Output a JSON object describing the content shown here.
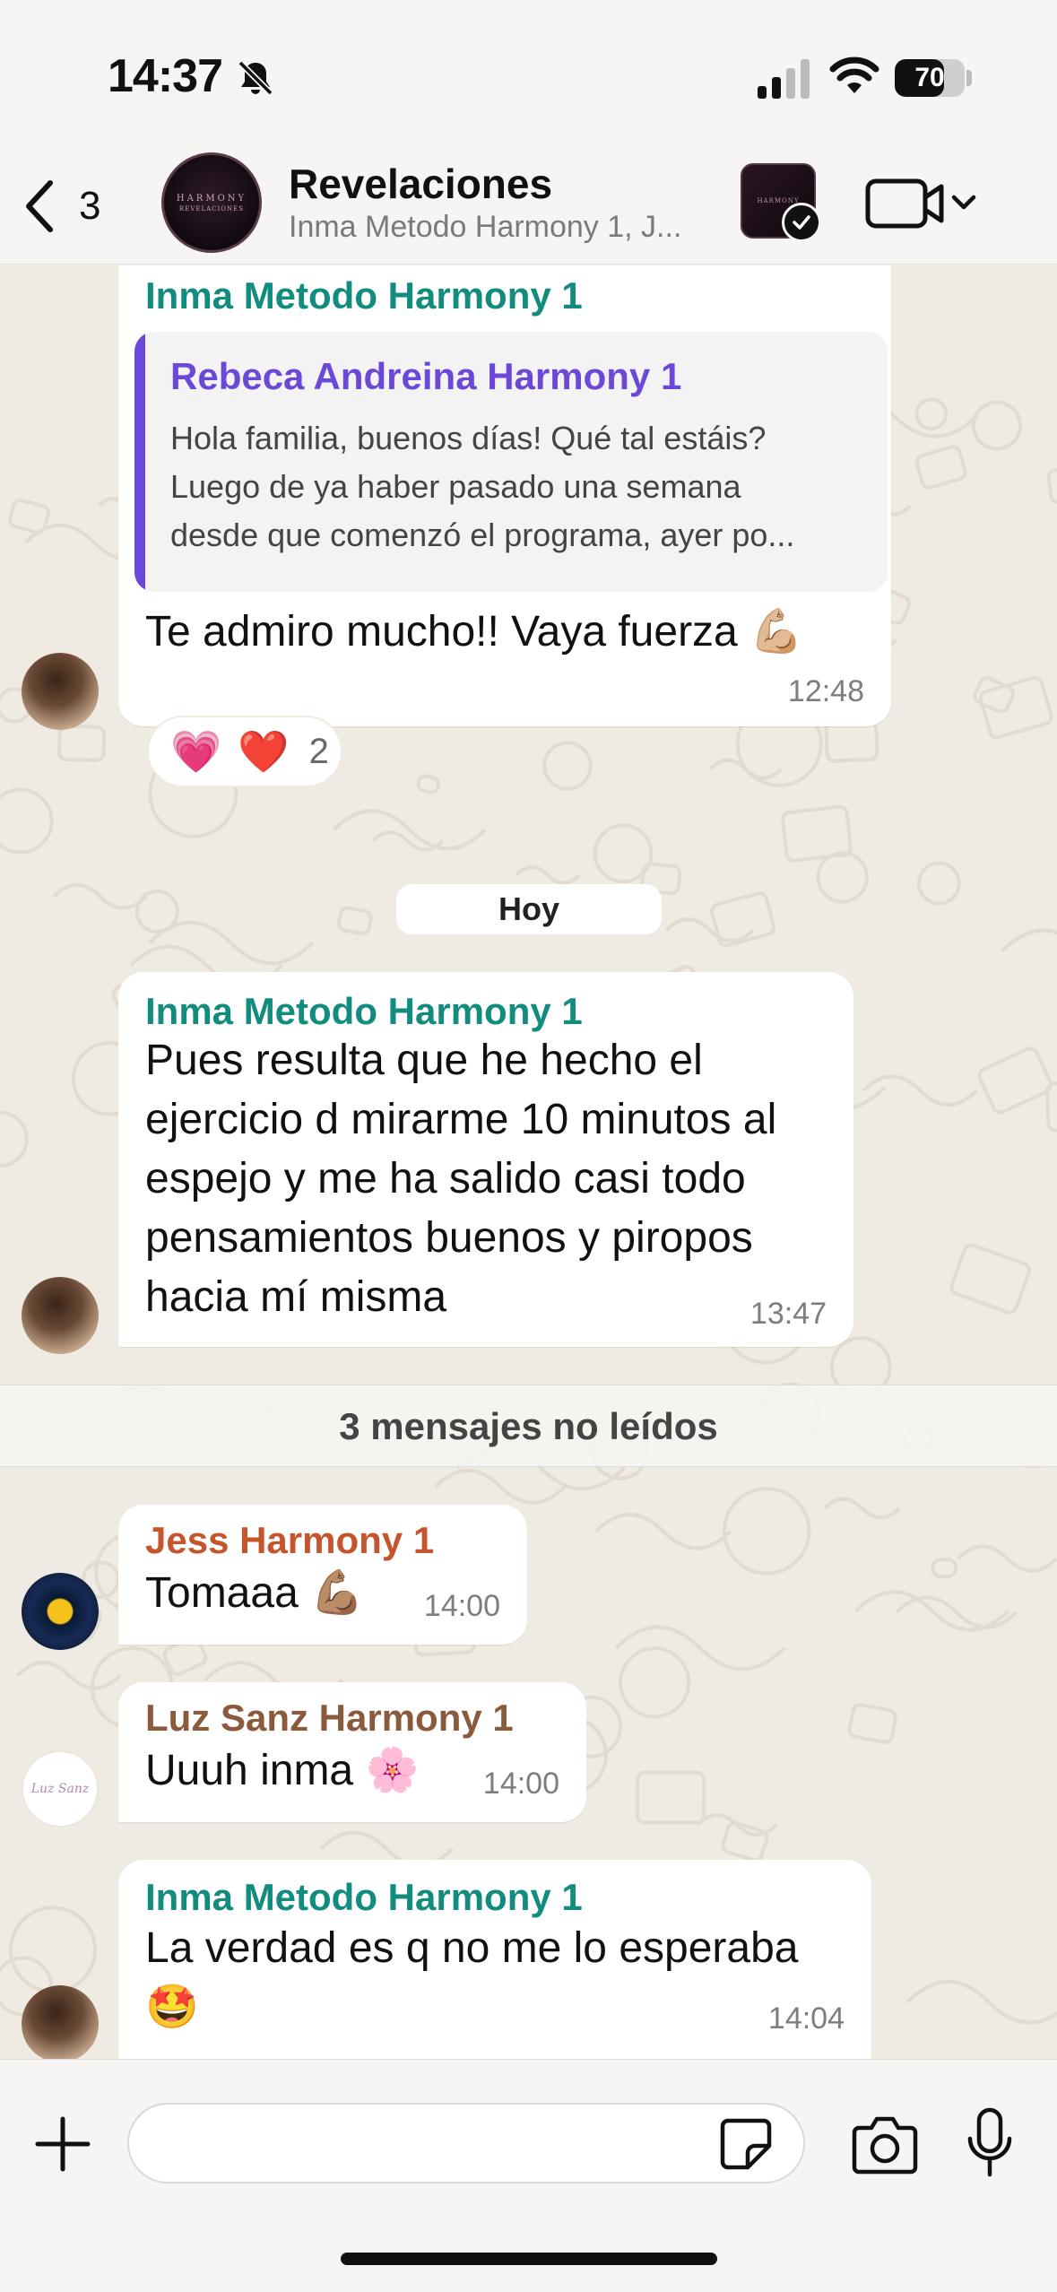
{
  "status_bar": {
    "time": "14:37",
    "battery_level": 70,
    "battery_text": "70",
    "icons": [
      "bell-slash-icon",
      "cellular-signal-icon",
      "wifi-icon",
      "battery-icon"
    ]
  },
  "header": {
    "back_count": "3",
    "group_name": "Revelaciones",
    "group_members": "Inma Metodo Harmony 1, J...",
    "avatar_line1": "HARMONY",
    "avatar_line2": "REVELACIONES",
    "thumb_text": "HARMONY",
    "icons": [
      "chevron-left-icon",
      "video-camera-icon",
      "chevron-down-icon",
      "checkmark-icon"
    ]
  },
  "messages": [
    {
      "sender": "Inma Metodo Harmony 1",
      "sender_color": "#128c7e",
      "quote": {
        "sender": "Rebeca Andreina Harmony 1",
        "sender_color": "#6b48d8",
        "lines": [
          "Hola familia, buenos días! Qué tal estáis?",
          "Luego de ya haber pasado una semana",
          "desde que comenzó el programa, ayer po..."
        ]
      },
      "text": "Te admiro mucho!! Vaya fuerza 💪🏼",
      "time": "12:48",
      "reactions": {
        "emojis": [
          "💗",
          "❤️"
        ],
        "count": "2"
      }
    },
    {
      "day_divider": "Hoy"
    },
    {
      "sender": "Inma Metodo Harmony 1",
      "sender_color": "#128c7e",
      "lines": [
        "Pues resulta que he hecho el",
        "ejercicio d mirarme 10 minutos al",
        "espejo y me ha salido casi todo",
        "pensamientos buenos y piropos",
        "hacia mí misma"
      ],
      "time": "13:47"
    },
    {
      "unread_banner": "3 mensajes no leídos"
    },
    {
      "sender": "Jess Harmony 1",
      "sender_color": "#c4552c",
      "text": "Tomaaa 💪🏽",
      "time": "14:00"
    },
    {
      "sender": "Luz Sanz Harmony 1",
      "sender_color": "#8a5a3c",
      "text": "Uuuh inma 🌸",
      "time": "14:00",
      "avatar_text": "Luz Sanz"
    },
    {
      "sender": "Inma Metodo Harmony 1",
      "sender_color": "#128c7e",
      "lines": [
        "La verdad es q no me lo esperaba",
        "🤩"
      ],
      "time": "14:04"
    }
  ],
  "input": {
    "value": "",
    "placeholder": "",
    "icons": [
      "plus-icon",
      "sticker-icon",
      "camera-icon",
      "microphone-icon"
    ]
  },
  "colors": {
    "background": "#efeae2",
    "bubble": "#ffffff",
    "bar": "#f6f5f3"
  }
}
